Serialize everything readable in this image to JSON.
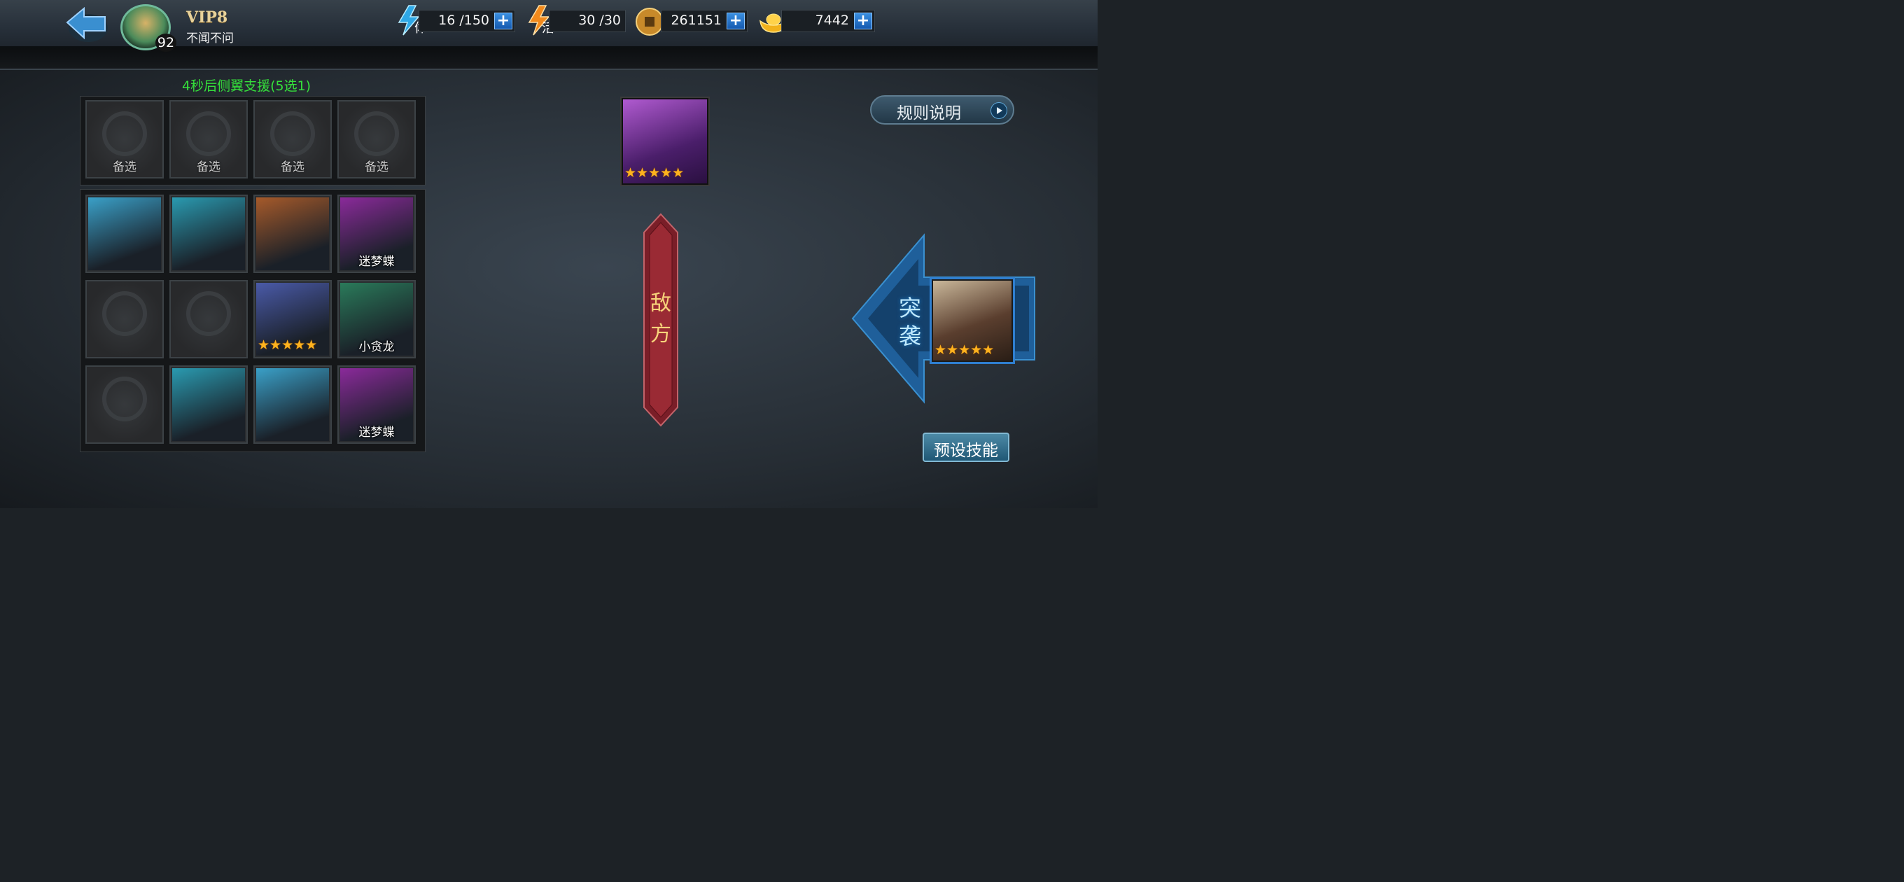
{
  "header": {
    "vip_label": "VIP8",
    "player_level": "92",
    "player_name": "不闻不问",
    "resources": [
      {
        "icon": "stamina-lightning-icon",
        "icon_char": "体",
        "value": "16 /150"
      },
      {
        "icon": "vitality-lightning-icon",
        "icon_char": "活",
        "value": "30 /30"
      },
      {
        "icon": "copper-coin-icon",
        "value": "261151"
      },
      {
        "icon": "gold-ingot-icon",
        "value": "7442"
      }
    ],
    "plus_label": "+"
  },
  "countdown": "4秒后侧翼支援(5选1)",
  "reserve_slots": [
    {
      "label": "备选"
    },
    {
      "label": "备选"
    },
    {
      "label": "备选"
    },
    {
      "label": "备选"
    }
  ],
  "hero_grid": [
    {
      "name": "",
      "stars": 0,
      "empty": false,
      "color": "#3aa0c8"
    },
    {
      "name": "",
      "stars": 0,
      "empty": false,
      "color": "#2a9ab0"
    },
    {
      "name": "",
      "stars": 0,
      "empty": false,
      "color": "#a65a2a"
    },
    {
      "name": "迷梦蝶",
      "stars": 0,
      "empty": false,
      "color": "#8a2a9a"
    },
    {
      "name": "",
      "stars": 0,
      "empty": true
    },
    {
      "name": "",
      "stars": 0,
      "empty": true
    },
    {
      "name": "",
      "stars": 5,
      "empty": false,
      "color": "#4a5aa8"
    },
    {
      "name": "小贪龙",
      "stars": 0,
      "empty": false,
      "color": "#2a7a5a"
    },
    {
      "name": "",
      "stars": 0,
      "empty": true
    },
    {
      "name": "",
      "stars": 0,
      "empty": false,
      "color": "#2a9ab0"
    },
    {
      "name": "",
      "stars": 0,
      "empty": false,
      "color": "#3aa0c8"
    },
    {
      "name": "迷梦蝶",
      "stars": 0,
      "empty": false,
      "color": "#8a2a9a"
    }
  ],
  "enemy": {
    "stars": 5,
    "color": "#7a3aa8"
  },
  "enemy_banner": "敌方",
  "rules_button": "规则说明",
  "attack_label": "突袭",
  "ally": {
    "stars": 5,
    "color": "#6a4a3a"
  },
  "preset_skill_button": "预设技能",
  "star_char": "★"
}
